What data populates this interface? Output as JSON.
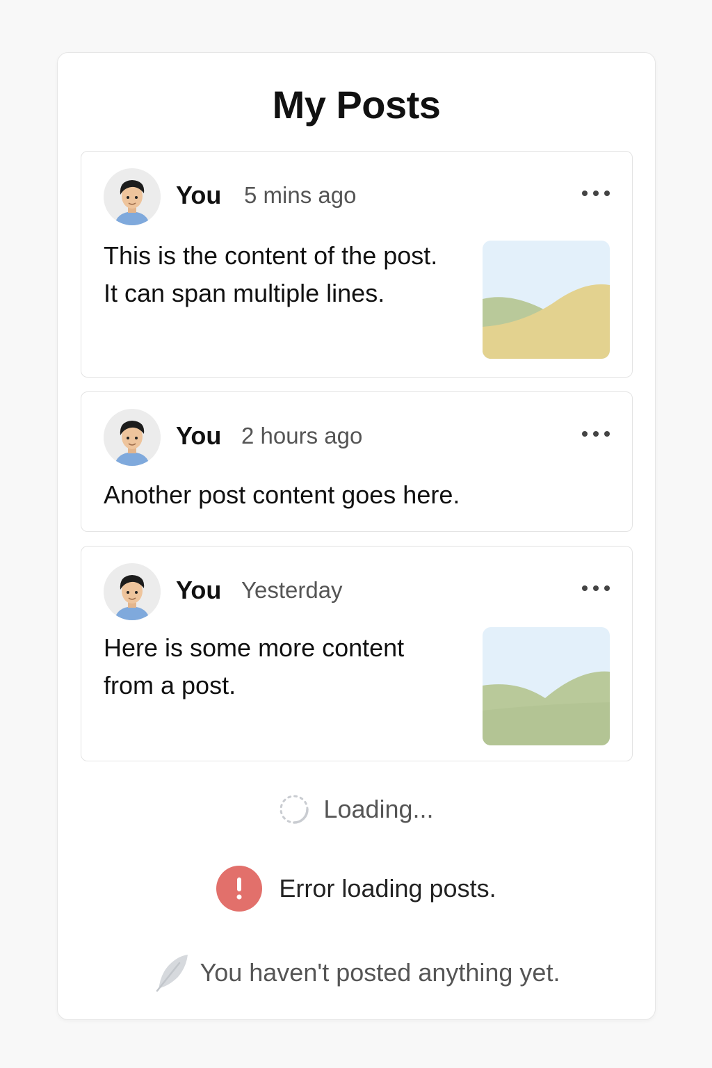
{
  "page": {
    "title": "My Posts"
  },
  "posts": [
    {
      "author": "You",
      "time": "5 mins ago",
      "text_lines": [
        "This is the content of the post.",
        "It can span multiple lines."
      ],
      "has_image": true,
      "more_label": "•••"
    },
    {
      "author": "You",
      "time": "2 hours ago",
      "text_lines": [
        "Another post content goes here."
      ],
      "has_image": false,
      "more_label": "•••"
    },
    {
      "author": "You",
      "time": "Yesterday",
      "text_lines": [
        "Here is some more content",
        "from a post."
      ],
      "has_image": true,
      "more_label": "•••"
    }
  ],
  "status": {
    "loading": "Loading...",
    "error": "Error loading posts.",
    "error_icon_glyph": "!",
    "empty": "You haven't posted anything yet."
  },
  "colors": {
    "error": "#e2706b",
    "sky": "#e3f0fa",
    "hill_green": "#b9c99a",
    "hill_yellow": "#e3d28f"
  },
  "icons": {
    "more": "more-horizontal-icon",
    "loading": "spinner-icon",
    "error": "exclamation-circle-icon",
    "empty": "feather-icon"
  }
}
